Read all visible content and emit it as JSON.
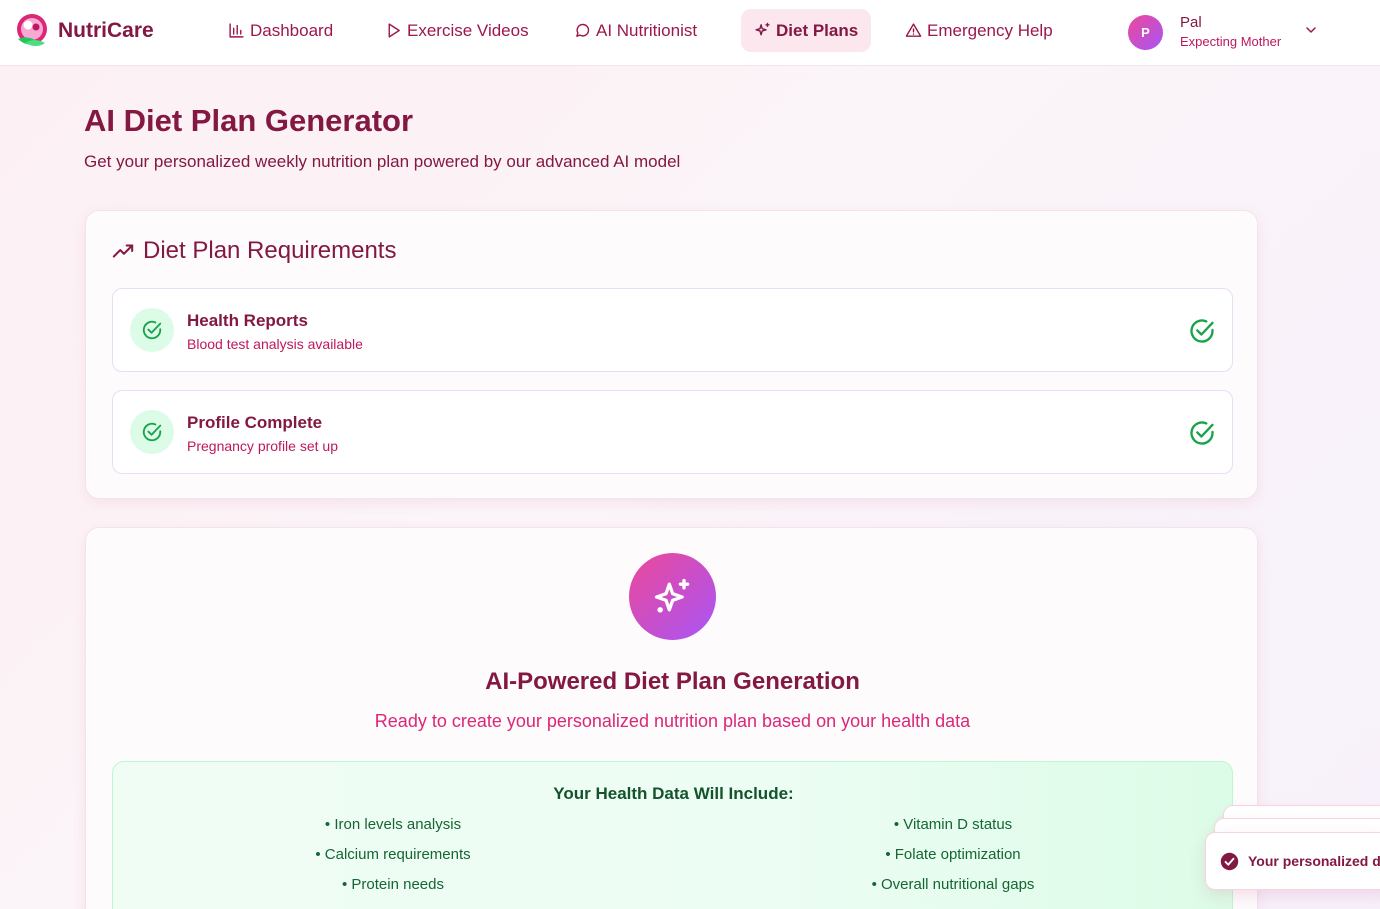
{
  "app": {
    "name": "NutriCare"
  },
  "nav": {
    "items": [
      {
        "label": "Dashboard",
        "icon": "bar-chart-icon",
        "active": false
      },
      {
        "label": "Exercise Videos",
        "icon": "play-icon",
        "active": false
      },
      {
        "label": "AI Nutritionist",
        "icon": "chat-bubble-icon",
        "active": false
      },
      {
        "label": "Diet Plans",
        "icon": "sparkles-icon",
        "active": true
      },
      {
        "label": "Emergency Help",
        "icon": "warning-triangle-icon",
        "active": false
      }
    ]
  },
  "user": {
    "initial": "P",
    "name": "Pal",
    "role": "Expecting Mother"
  },
  "page": {
    "title": "AI Diet Plan Generator",
    "subtitle": "Get your personalized weekly nutrition plan powered by our advanced AI model"
  },
  "requirements": {
    "title": "Diet Plan Requirements",
    "items": [
      {
        "name": "Health Reports",
        "description": "Blood test analysis available",
        "status": "complete"
      },
      {
        "name": "Profile Complete",
        "description": "Pregnancy profile set up",
        "status": "complete"
      }
    ]
  },
  "generation": {
    "title": "AI-Powered Diet Plan Generation",
    "subtitle": "Ready to create your personalized nutrition plan based on your health data",
    "health_data": {
      "title": "Your Health Data Will Include:",
      "left": [
        "• Iron levels analysis",
        "• Calcium requirements",
        "• Protein needs"
      ],
      "right": [
        "• Vitamin D status",
        "• Folate optimization",
        "• Overall nutritional gaps"
      ]
    }
  },
  "toast": {
    "message": "Your personalized die"
  },
  "colors": {
    "brand": "#831843",
    "accent": "#db2777",
    "active_nav_bg": "#fce7ef",
    "success": "#16a34a",
    "gradient_start": "#ec4899",
    "gradient_end": "#a855f7"
  }
}
